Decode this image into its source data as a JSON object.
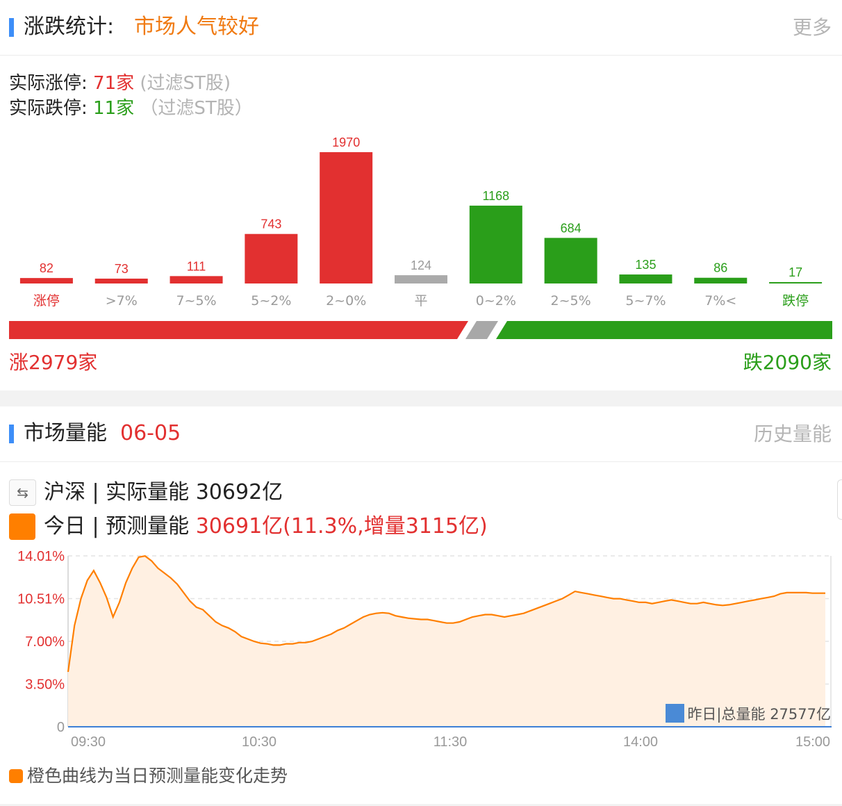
{
  "stats_section": {
    "title": "涨跌统计:",
    "mood": "市场人气较好",
    "more_label": "更多",
    "limit_up": {
      "label": "实际涨停:",
      "count": "71家",
      "note": "(过滤ST股)"
    },
    "limit_down": {
      "label": "实际跌停:",
      "count": "11家",
      "note": "（过滤ST股）"
    },
    "rise_total": "涨2979家",
    "fall_total": "跌2090家"
  },
  "chart_data": [
    {
      "type": "bar",
      "categories": [
        "涨停",
        ">7%",
        "7~5%",
        "5~2%",
        "2~0%",
        "平",
        "0~2%",
        "2~5%",
        "5~7%",
        "7%<",
        "跌停"
      ],
      "values": [
        82,
        73,
        111,
        743,
        1970,
        124,
        1168,
        684,
        135,
        86,
        17
      ],
      "bar_colors": [
        "#e23030",
        "#e23030",
        "#e23030",
        "#e23030",
        "#e23030",
        "#aaaaaa",
        "#2a9e1a",
        "#2a9e1a",
        "#2a9e1a",
        "#2a9e1a",
        "#2a9e1a"
      ],
      "label_colors": [
        "#e23030",
        "#e23030",
        "#e23030",
        "#e23030",
        "#e23030",
        "#9a9a9a",
        "#2a9e1a",
        "#2a9e1a",
        "#2a9e1a",
        "#2a9e1a",
        "#2a9e1a"
      ],
      "category_colors": [
        "#e23030",
        "#9a9a9a",
        "#9a9a9a",
        "#9a9a9a",
        "#9a9a9a",
        "#9a9a9a",
        "#9a9a9a",
        "#9a9a9a",
        "#9a9a9a",
        "#9a9a9a",
        "#2a9e1a"
      ]
    },
    {
      "type": "area",
      "color": "#ff7f00",
      "fill": "#fff0e2",
      "x_ticks": [
        "09:30",
        "10:30",
        "11:30",
        "14:00",
        "15:00"
      ],
      "y_ticks": [
        "0",
        "3.50%",
        "7.00%",
        "10.51%",
        "14.01%"
      ],
      "ylim": [
        0,
        14.01
      ],
      "baseline_label": "昨日|总量能 27577亿",
      "baseline_color": "#3d7fd6",
      "y": [
        4.5,
        8.3,
        10.5,
        12.0,
        12.8,
        11.8,
        10.6,
        9.0,
        10.2,
        11.8,
        13.0,
        13.9,
        14.0,
        13.6,
        13.0,
        12.6,
        12.2,
        11.7,
        11.0,
        10.3,
        9.8,
        9.6,
        9.1,
        8.6,
        8.3,
        8.1,
        7.8,
        7.4,
        7.2,
        7.0,
        6.85,
        6.8,
        6.7,
        6.7,
        6.8,
        6.8,
        6.9,
        6.9,
        7.0,
        7.2,
        7.4,
        7.6,
        7.9,
        8.1,
        8.4,
        8.7,
        9.0,
        9.2,
        9.3,
        9.35,
        9.3,
        9.1,
        9.0,
        8.9,
        8.85,
        8.8,
        8.8,
        8.7,
        8.6,
        8.5,
        8.5,
        8.6,
        8.8,
        9.0,
        9.1,
        9.2,
        9.2,
        9.1,
        9.0,
        9.1,
        9.2,
        9.3,
        9.5,
        9.7,
        9.9,
        10.1,
        10.3,
        10.5,
        10.8,
        11.1,
        11.0,
        10.9,
        10.8,
        10.7,
        10.6,
        10.5,
        10.5,
        10.4,
        10.3,
        10.2,
        10.2,
        10.1,
        10.2,
        10.3,
        10.4,
        10.3,
        10.2,
        10.1,
        10.1,
        10.2,
        10.1,
        10.0,
        9.95,
        10.0,
        10.1,
        10.2,
        10.3,
        10.4,
        10.5,
        10.6,
        10.7,
        10.9,
        11.0,
        11.0,
        11.0,
        11.0,
        10.95,
        10.95,
        10.95
      ]
    }
  ],
  "volume_section": {
    "title": "市场量能",
    "date": "06-05",
    "history_label": "历史量能",
    "swap_icon": "⇆",
    "row1_label": "沪深 | 实际量能 ",
    "row1_value": "30692亿",
    "row2_label": "今日 | 预测量能 ",
    "row2_value": "30691亿(11.3%,增量3115亿)",
    "legend_note": "橙色曲线为当日预测量能变化走势"
  },
  "colors": {
    "red": "#e23030",
    "green": "#2a9e1a",
    "orange": "#ff7f00",
    "accent_blue": "#3d8ef8",
    "flat_gray": "#aaaaaa"
  }
}
